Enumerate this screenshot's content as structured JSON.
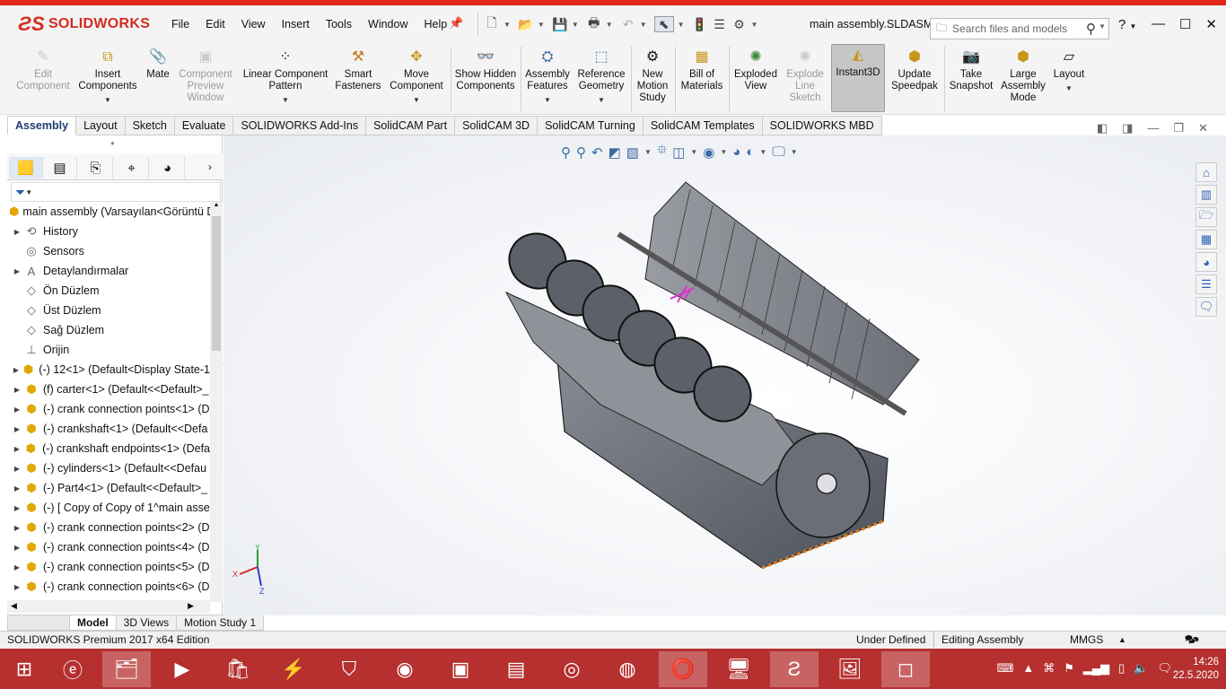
{
  "app": {
    "logo_text": "SOLIDWORKS",
    "document_title": "main assembly.SLDASM",
    "menu": [
      "File",
      "Edit",
      "View",
      "Insert",
      "Tools",
      "Window",
      "Help"
    ],
    "search_placeholder": "Search files and models",
    "help_label": "?"
  },
  "ribbon": {
    "edit_component": "Edit Component",
    "insert_components": "Insert Components",
    "mate": "Mate",
    "component_preview": "Component Preview Window",
    "linear_pattern": "Linear Component Pattern",
    "smart_fasteners": "Smart Fasteners",
    "move_component": "Move Component",
    "show_hidden": "Show Hidden Components",
    "assembly_features": "Assembly Features",
    "reference_geometry": "Reference Geometry",
    "new_motion": "New Motion Study",
    "bom": "Bill of Materials",
    "exploded_view": "Exploded View",
    "explode_line": "Explode Line Sketch",
    "instant3d": "Instant3D",
    "update_speedpak": "Update Speedpak",
    "take_snapshot": "Take Snapshot",
    "large_assembly": "Large Assembly Mode",
    "layout": "Layout"
  },
  "command_tabs": [
    "Assembly",
    "Layout",
    "Sketch",
    "Evaluate",
    "SOLIDWORKS Add-Ins",
    "SolidCAM Part",
    "SolidCAM 3D",
    "SolidCAM Turning",
    "SolidCAM Templates",
    "SOLIDWORKS MBD"
  ],
  "tree": {
    "root": "main assembly  (Varsayılan<Görüntü D",
    "items": [
      {
        "label": "History",
        "icon": "history-icon",
        "expand": true
      },
      {
        "label": "Sensors",
        "icon": "sensor-icon",
        "expand": false
      },
      {
        "label": "Detaylandırmalar",
        "icon": "annotations-icon",
        "expand": true
      },
      {
        "label": "Ön Düzlem",
        "icon": "plane-icon",
        "expand": false
      },
      {
        "label": "Üst Düzlem",
        "icon": "plane-icon",
        "expand": false
      },
      {
        "label": "Sağ Düzlem",
        "icon": "plane-icon",
        "expand": false
      },
      {
        "label": "Orijin",
        "icon": "origin-icon",
        "expand": false
      },
      {
        "label": "(-) 12<1> (Default<Display State-1",
        "icon": "assembly-icon",
        "expand": true
      },
      {
        "label": "(f) carter<1> (Default<<Default>_",
        "icon": "part-icon",
        "expand": true
      },
      {
        "label": "(-) crank connection points<1> (D",
        "icon": "part-icon",
        "expand": true
      },
      {
        "label": "(-) crankshaft<1> (Default<<Defa",
        "icon": "part-icon",
        "expand": true
      },
      {
        "label": "(-) crankshaft endpoints<1> (Defa",
        "icon": "part-icon",
        "expand": true
      },
      {
        "label": "(-) cylinders<1> (Default<<Defau",
        "icon": "part-icon",
        "expand": true
      },
      {
        "label": "(-) Part4<1> (Default<<Default>_",
        "icon": "part-icon",
        "expand": true
      },
      {
        "label": "(-) [ Copy of Copy of 1^main asse",
        "icon": "part-icon",
        "expand": true
      },
      {
        "label": "(-) crank connection points<2> (D",
        "icon": "part-icon",
        "expand": true
      },
      {
        "label": "(-) crank connection points<4> (D",
        "icon": "part-icon",
        "expand": true
      },
      {
        "label": "(-) crank connection points<5> (D",
        "icon": "part-icon",
        "expand": true
      },
      {
        "label": "(-) crank connection points<6> (D",
        "icon": "part-icon",
        "expand": true
      }
    ]
  },
  "bottom_tabs": [
    "Model",
    "3D Views",
    "Motion Study 1"
  ],
  "axis": {
    "x": "X",
    "y": "Y",
    "z": "Z"
  },
  "status": {
    "edition": "SOLIDWORKS Premium 2017 x64 Edition",
    "state": "Under Defined",
    "mode": "Editing Assembly",
    "units": "MMGS"
  },
  "clock": {
    "time": "14:26",
    "date": "22.5.2020"
  },
  "colors": {
    "accent": "#d52b1e",
    "taskbar": "#b5302f",
    "ribbon_bg": "#f4f4f4"
  }
}
